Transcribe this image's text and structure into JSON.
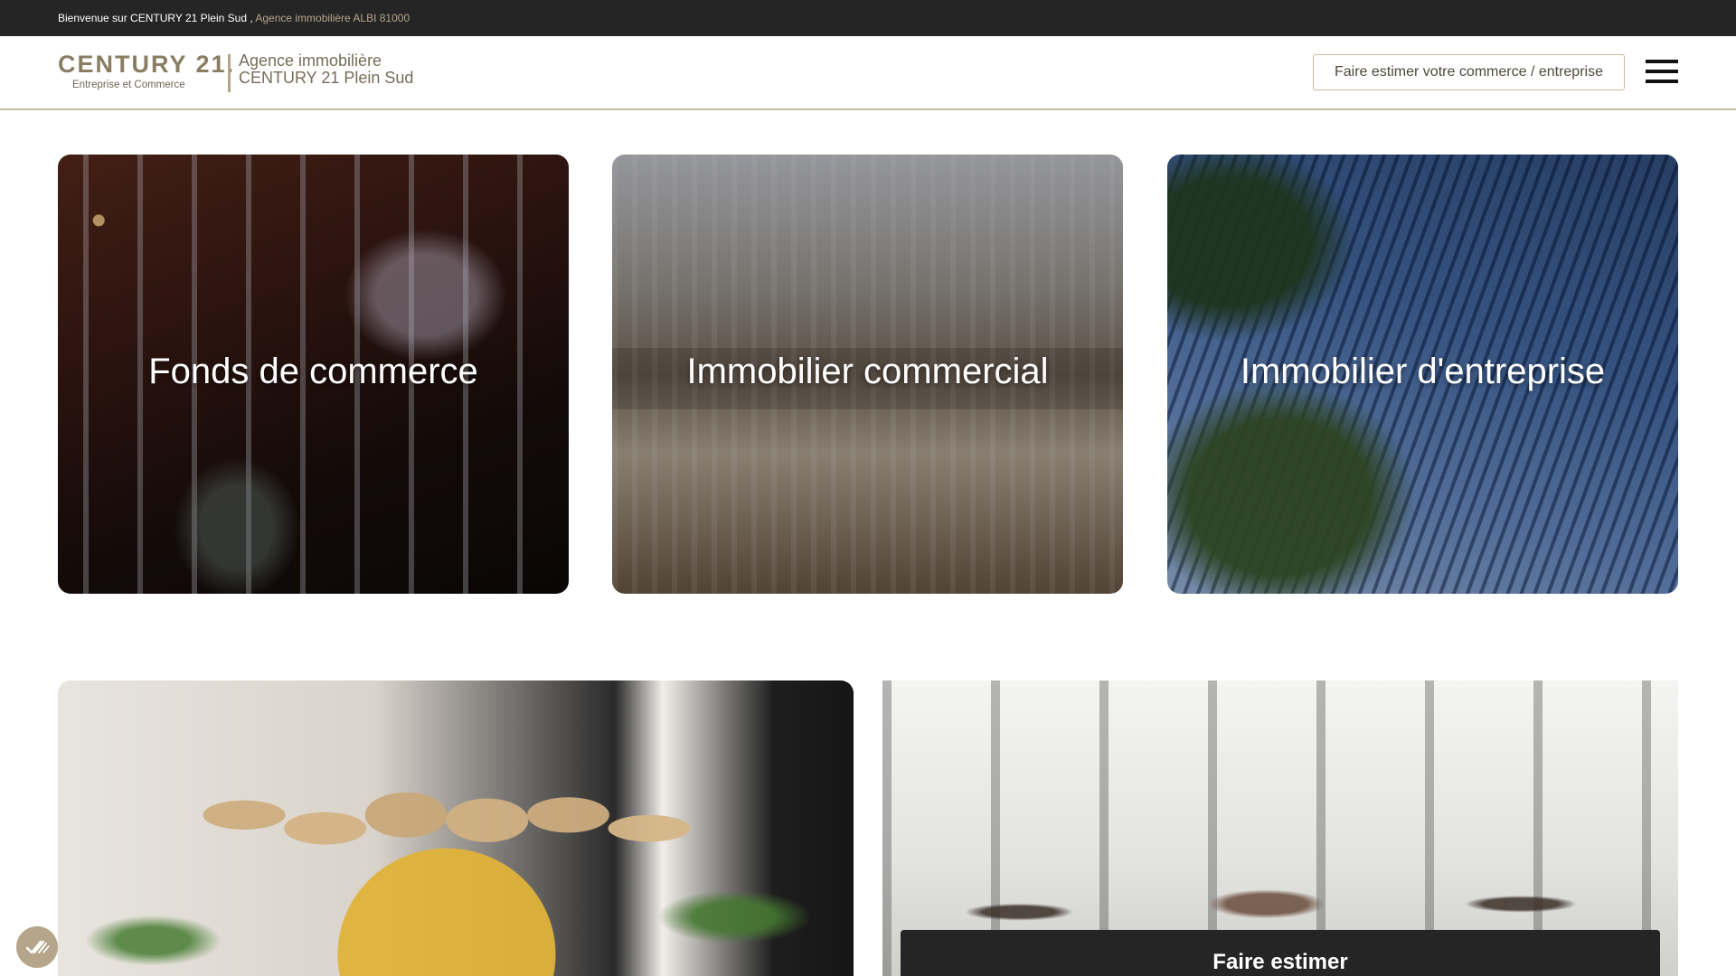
{
  "topbar": {
    "welcome_text": "Bienvenue sur CENTURY 21 Plein Sud ,",
    "agency_location": "Agence immobilière ALBI 81000"
  },
  "header": {
    "logo_main": "CENTURY 21.",
    "logo_sub": "Entreprise et Commerce",
    "agency_line1": "Agence immobilière",
    "agency_line2": "CENTURY 21 Plein Sud",
    "estimate_button_label": "Faire estimer votre commerce / entreprise",
    "menu_icon": "hamburger-menu-icon"
  },
  "categories": [
    {
      "title": "Fonds de commerce"
    },
    {
      "title": "Immobilier commercial"
    },
    {
      "title": "Immobilier d'entreprise"
    }
  ],
  "lower": {
    "estimate_panel_title": "Faire estimer"
  },
  "floating": {
    "privacy_icon": "check-cookie-icon"
  },
  "colors": {
    "topbar_bg": "#252526",
    "accent_gold": "#b5a58a",
    "brand_text": "#8a7e62"
  }
}
